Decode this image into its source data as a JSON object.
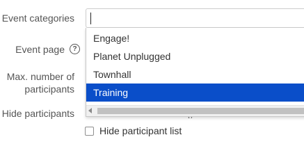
{
  "form": {
    "event_categories_label": "Event categories",
    "event_page_label": "Event page",
    "max_participants_label": "Max. number of participants",
    "hide_participants_label": "Hide participants",
    "hide_participant_list_label": "Hide participant list",
    "help_glyph": "?"
  },
  "categories_input": {
    "value": ""
  },
  "dropdown": {
    "options": [
      "Engage!",
      "Planet Unplugged",
      "Townhall",
      "Training"
    ],
    "selected": "Training"
  },
  "colors": {
    "selection": "#0a4ec9",
    "label": "#555555",
    "text": "#333333"
  },
  "icons": {
    "help": "question-circle-icon",
    "scroll_left": "chevron-left-icon"
  }
}
